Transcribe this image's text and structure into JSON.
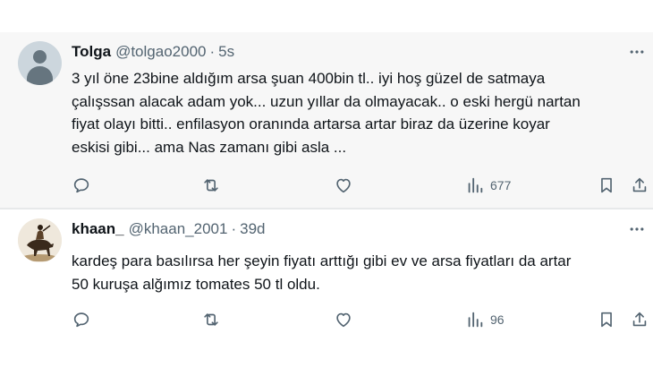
{
  "tweets": [
    {
      "name": "Tolga",
      "handle": "@tolgao2000",
      "separator": "·",
      "time": "5s",
      "text_lines": [
        "3 yıl öne 23bine aldığım arsa şuan 400bin tl.. iyi hoş güzel de satmaya",
        "çalışssan alacak adam yok... uzun yıllar da olmayacak.. o eski hergü nartan",
        "fiyat olayı bitti.. enfilasyon oranında artarsa artar biraz da üzerine koyar",
        "eskisi gibi... ama Nas zamanı gibi asla ..."
      ],
      "views": "677"
    },
    {
      "name": "khaan_",
      "handle": "@khaan_2001",
      "separator": "·",
      "time": "39d",
      "text_lines": [
        "kardeş para basılırsa her şeyin fiyatı arttığı gibi ev ve arsa fiyatları da artar",
        "50 kuruşa alğımız tomates 50 tl oldu."
      ],
      "views": "96"
    }
  ],
  "icons": {
    "reply": "reply-icon",
    "retweet": "retweet-icon",
    "like": "heart-icon",
    "views": "views-icon",
    "bookmark": "bookmark-icon",
    "share": "share-icon",
    "more": "more-icon"
  },
  "colors": {
    "icon": "#536471",
    "text": "#0f1419",
    "secondary": "#536471",
    "highlight_bg": "#f7f7f7"
  }
}
